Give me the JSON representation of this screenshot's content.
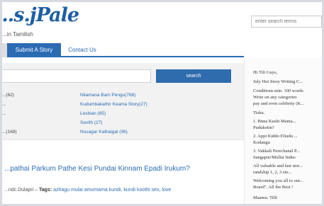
{
  "header": {
    "logo": "...s.jPale",
    "tagline": "...in Tamilish",
    "search_placeholder": "enter search terms"
  },
  "nav": {
    "items": [
      {
        "label": ""
      },
      {
        "label": "Submit A Story"
      },
      {
        "label": "Contact Us"
      }
    ]
  },
  "search_panel": {
    "button_label": "search"
  },
  "categories": {
    "left": [
      "...(62)",
      "...",
      "...",
      "...(169)"
    ],
    "right": [
      "Nilamana Bam Pengu(768)",
      "Kudumbakathir Keama Story(27)",
      "Lesbian (65)",
      "Sevith (27)",
      "Nusagar Kathaigal (96)"
    ]
  },
  "post": {
    "title": "...pathai Parkum Pathe Kesi Pundai Kinnam Epadi Irukum?",
    "meta_prefix": "...ndc.Dulapri – ",
    "tags_label": "Tags:",
    "tags": "azhagu mulai amomama kundi, kundi koothi sex, love"
  },
  "sidebar": {
    "lines": [
      "Hi Tili Guys,",
      "July Hot Story Writing C...",
      "Conditions min. 100 words",
      "Write on any categories",
      "pay and even celebrity (K...",
      "Tisku.",
      "1.   Bnna Kushi Mama...",
      "Pudukotin?",
      "2.   Appi Kiddo Eliudu ...",
      "Kodangu",
      "3.   Vakkali Perechanal P...",
      "Sangapur/Mullai Indus",
      "All valuable and fast stor...",
      "randship 1, 2, 3 ete...",
      "Welcoming you all to our...",
      "Board\". All the Best !",
      "Maamu. Tilli"
    ]
  }
}
